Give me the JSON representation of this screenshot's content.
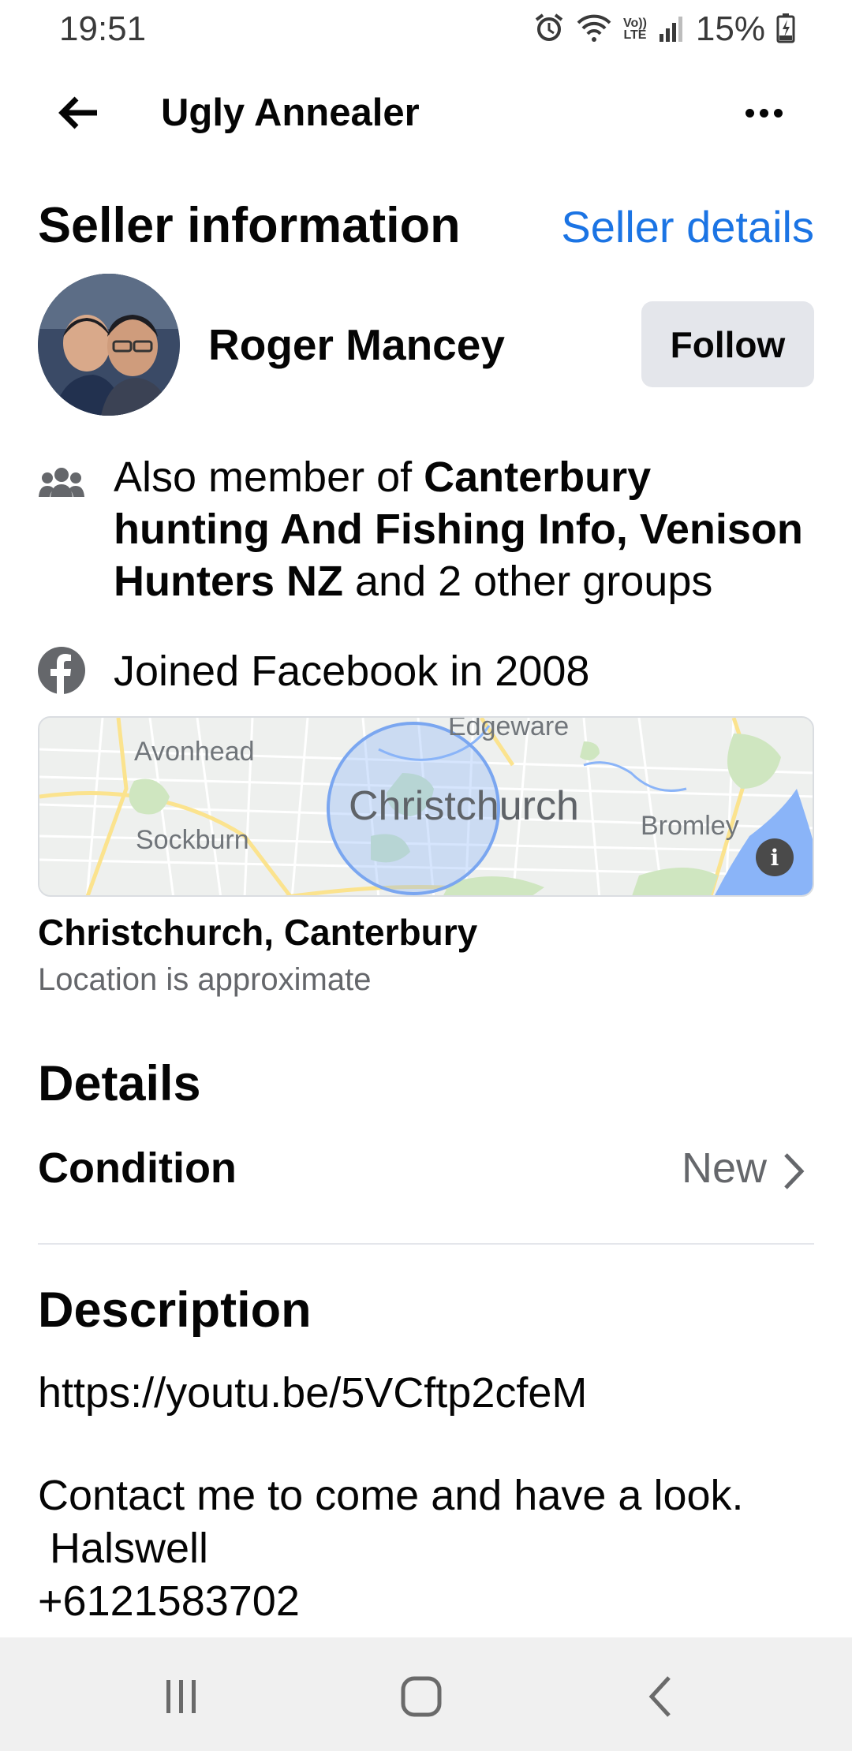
{
  "status_bar": {
    "time": "19:51",
    "volte_top": "Vo))",
    "volte_bottom": "LTE",
    "battery_percent": "15%"
  },
  "header": {
    "title": "Ugly Annealer",
    "back_icon": "arrow-left-icon",
    "more_icon": "more-horizontal-icon"
  },
  "seller": {
    "section_title": "Seller information",
    "details_link": "Seller details",
    "name": "Roger Mancey",
    "follow_label": "Follow",
    "groups": {
      "prefix": "Also member of ",
      "group_names": "Canterbury hunting And Fishing Info, Venison Hunters NZ",
      "suffix": " and 2 other groups"
    },
    "joined": "Joined Facebook in 2008"
  },
  "map": {
    "city": "Christchurch",
    "labels": {
      "avonhead": "Avonhead",
      "sockburn": "Sockburn",
      "edgeware": "Edgeware",
      "bromley": "Bromley"
    },
    "info_glyph": "i"
  },
  "location": {
    "name": "Christchurch, Canterbury",
    "note": "Location is approximate"
  },
  "details": {
    "title": "Details",
    "condition_label": "Condition",
    "condition_value": "New"
  },
  "description": {
    "title": "Description",
    "link": "https://youtu.be/5VCftp2cfeM",
    "lines": [
      "Contact me to come and have a look.",
      " Halswell",
      "+6121583702"
    ]
  },
  "colors": {
    "link_blue": "#1b74e4",
    "button_grey": "#e4e6eb",
    "secondary_text": "#65676b"
  }
}
